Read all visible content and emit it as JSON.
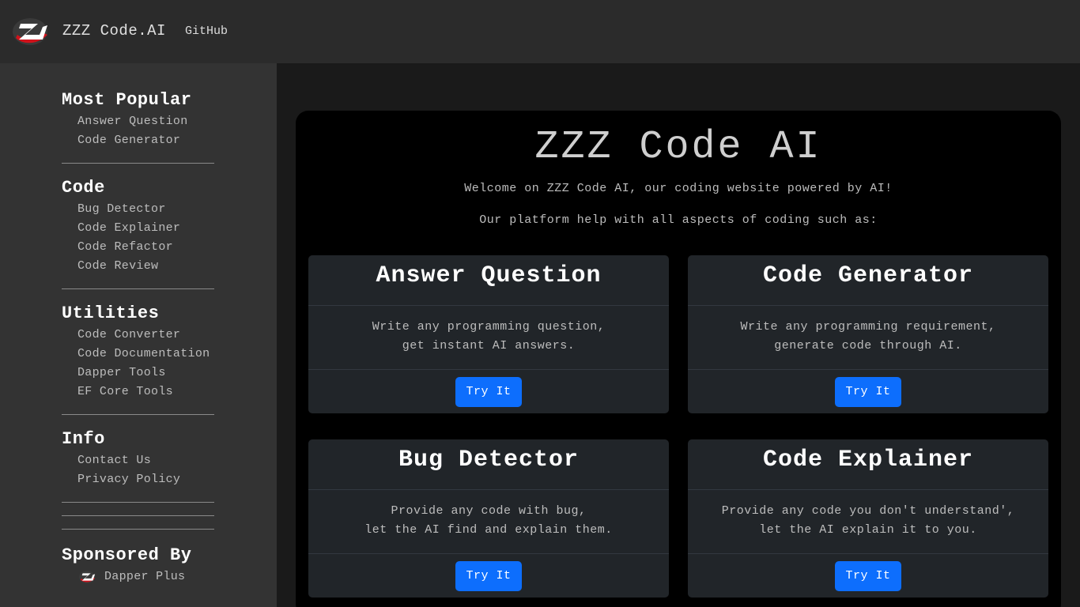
{
  "header": {
    "brand": "ZZZ Code.AI",
    "github_link": "GitHub"
  },
  "sidebar": {
    "sections": [
      {
        "heading": "Most Popular",
        "items": [
          "Answer Question",
          "Code Generator"
        ]
      },
      {
        "heading": "Code",
        "items": [
          "Bug Detector",
          "Code Explainer",
          "Code Refactor",
          "Code Review"
        ]
      },
      {
        "heading": "Utilities",
        "items": [
          "Code Converter",
          "Code Documentation",
          "Dapper Tools",
          "EF Core Tools"
        ]
      },
      {
        "heading": "Info",
        "items": [
          "Contact Us",
          "Privacy Policy"
        ]
      }
    ],
    "sponsor": {
      "heading": "Sponsored By",
      "item": "Dapper Plus"
    }
  },
  "main": {
    "title": "ZZZ Code AI",
    "welcome": "Welcome on ZZZ Code AI, our coding website powered by AI!",
    "intro": "Our platform help with all aspects of coding such as:",
    "cards": [
      {
        "title": "Answer Question",
        "line1": "Write any programming question,",
        "line2": "get instant AI answers.",
        "button": "Try It"
      },
      {
        "title": "Code Generator",
        "line1": "Write any programming requirement,",
        "line2": "generate code through AI.",
        "button": "Try It"
      },
      {
        "title": "Bug Detector",
        "line1": "Provide any code with bug,",
        "line2": "let the AI find and explain them.",
        "button": "Try It"
      },
      {
        "title": "Code Explainer",
        "line1": "Provide any code you don't understand',",
        "line2": "let the AI explain it to you.",
        "button": "Try It"
      }
    ]
  },
  "colors": {
    "navbar_bg": "#2b2b2b",
    "sidebar_bg": "#333333",
    "main_bg": "#000000",
    "card_bg": "#212529",
    "button_bg": "#0d6efd",
    "logo_red": "#d0121b"
  },
  "icons": {
    "logo": "zzz-logo-icon",
    "sponsor_logo": "dapper-plus-logo-icon"
  }
}
